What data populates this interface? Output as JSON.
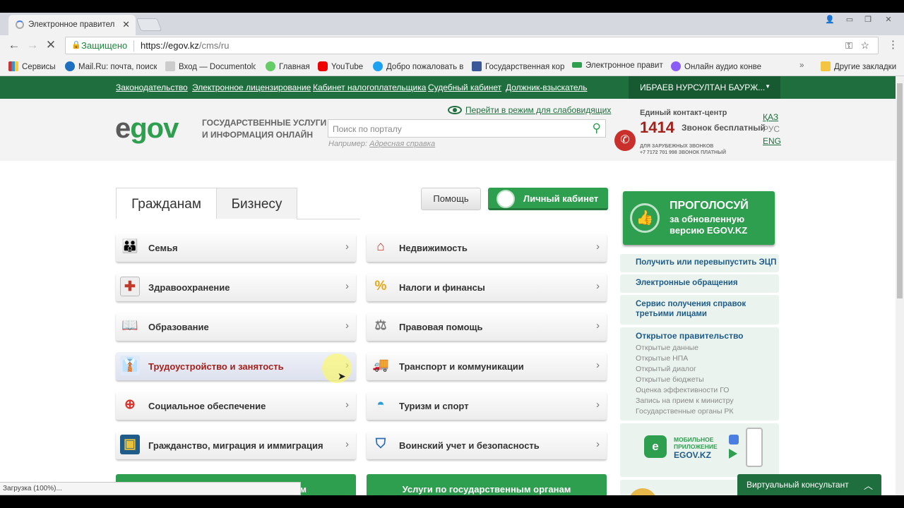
{
  "browser": {
    "tab_title": "Электронное правител",
    "security_label": "Защищено",
    "url_host": "https://egov.kz",
    "url_path": "/cms/ru",
    "bookmarks": [
      "Сервисы",
      "Mail.Ru: почта, поиск",
      "Вход — Documentolog",
      "Главная",
      "YouTube",
      "Добро пожаловать в",
      "Государственная кор",
      "Электронное правит",
      "Онлайн аудио конве"
    ],
    "other_bookmarks": "Другие закладки",
    "status": "Загрузка (100%)..."
  },
  "topnav": {
    "links": [
      "Законодательство",
      "Электронное лицензирование",
      "Кабинет налогоплательщика",
      "Судебный кабинет",
      "Должник-взыскатель"
    ],
    "user": "ИБРАЕВ НУРСУЛТАН БАУРЖ..."
  },
  "header": {
    "logo_e": "e",
    "logo_gov": "gov",
    "tagline_1": "ГОСУДАРСТВЕННЫЕ УСЛУГИ",
    "tagline_2": "И ИНФОРМАЦИЯ ОНЛАЙН",
    "impaired_link": "Перейти в режим для слабовидящих",
    "search_placeholder": "Поиск по порталу",
    "example_prefix": "Например:",
    "example_link": "Адресная справка",
    "contact_label": "Единый контакт-центр",
    "contact_number": "1414",
    "contact_free": "Звонок бесплатный",
    "contact_small_1": "ДЛЯ ЗАРУБЕЖНЫХ ЗВОНКОВ",
    "contact_small_2": "+7 7172 701 998 ЗВОНОК ПЛАТНЫЙ",
    "langs": [
      "ҚАЗ",
      "РУС",
      "ENG"
    ]
  },
  "tabs": [
    "Гражданам",
    "Бизнесу"
  ],
  "buttons": {
    "help": "Помощь",
    "cabinet": "Личный кабинет"
  },
  "categories_left": [
    "Семья",
    "Здравоохранение",
    "Образование",
    "Трудоустройство и занятость",
    "Социальное обеспечение",
    "Гражданство, миграция и иммиграция"
  ],
  "categories_right": [
    "Недвижимость",
    "Налоги и финансы",
    "Правовая помощь",
    "Транспорт и коммуникации",
    "Туризм и спорт",
    "Воинский учет и безопасность"
  ],
  "bottom_bars": {
    "left": "м",
    "right": "Услуги по государственным органам"
  },
  "vote": {
    "title": "ПРОГОЛОСУЙ",
    "line1": "за обновленную",
    "line2": "версию EGOV.KZ"
  },
  "right_links": [
    "Получить или перевыпустить ЭЦП",
    "Электронные обращения",
    "Сервис получения справок третьими лицами"
  ],
  "open_gov": {
    "title": "Открытое правительство",
    "items": [
      "Открытые данные",
      "Открытые НПА",
      "Открытый диалог",
      "Открытые бюджеты",
      "Оценка эффективности ГО",
      "Запись на прием к министру",
      "Государственные органы РК"
    ]
  },
  "mobile": {
    "line1": "МОБИЛЬНОЕ",
    "line2": "ПРИЛОЖЕНИЕ",
    "brand": "EGOV.KZ"
  },
  "virtual_consultant": "Виртуальный консультант",
  "colors": {
    "brand_green": "#2e9e4f",
    "dark_green": "#1f6e3e",
    "accent_red": "#a3211b",
    "link_blue": "#1f5c8a"
  }
}
